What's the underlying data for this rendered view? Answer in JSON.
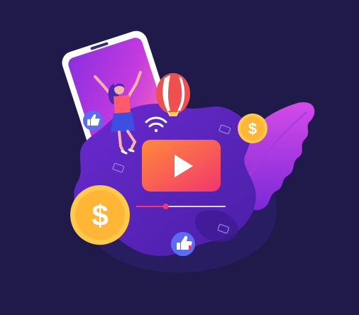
{
  "scene": {
    "background_color": "#1f1a4a",
    "palette": {
      "purple_deep": "#3a1e8a",
      "purple_mid": "#5b24c2",
      "magenta": "#c23be6",
      "play_orange": "#ff8a3a",
      "play_pink": "#f2366e",
      "coin_yellow": "#ffc94a",
      "badge_blue": "#5c6cf2",
      "balloon_red": "#f0504d"
    },
    "icons": {
      "coin_large": "dollar-coin",
      "coin_small": "dollar-coin",
      "play": "play-triangle",
      "wifi": "wifi-signal",
      "like_left": "thumbs-up",
      "like_bottom": "thumbs-up",
      "balloon": "hot-air-balloon"
    },
    "coin_large_symbol": "$",
    "coin_small_symbol": "$",
    "video_progress": 0.33
  }
}
